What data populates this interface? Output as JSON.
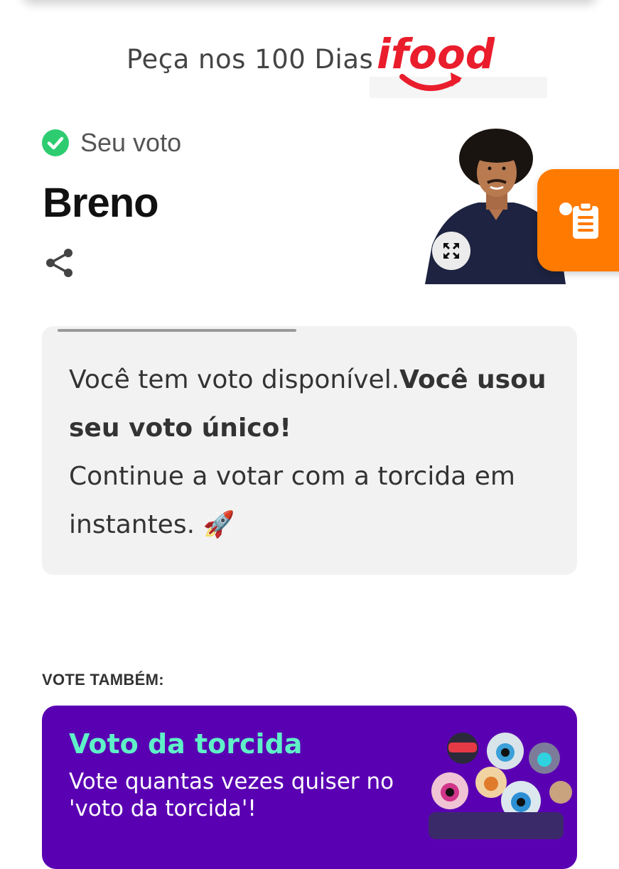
{
  "sponsor": {
    "text": "Peça nos 100 Dias",
    "logo_text": "ifood"
  },
  "vote": {
    "label": "Seu voto",
    "candidate": "Breno"
  },
  "message": {
    "part1": "Você tem voto disponível.",
    "part2_bold": "Você usou seu voto único!",
    "part3": "Continue a votar com a torcida em instantes. 🚀"
  },
  "also": {
    "title": "VOTE TAMBÉM:",
    "card_title": "Voto da torcida",
    "card_description": "Vote quantas vezes quiser no 'voto da torcida'!"
  },
  "colors": {
    "brand_red": "#ea1d2c",
    "check_green": "#2ecc71",
    "floating_orange": "#ff7a00",
    "card_purple": "#5a00b3",
    "card_title_mint": "#5ff0c8"
  },
  "icons": [
    "check-circle-icon",
    "share-icon",
    "expand-icon",
    "clipboard-icon",
    "rocket-emoji"
  ]
}
